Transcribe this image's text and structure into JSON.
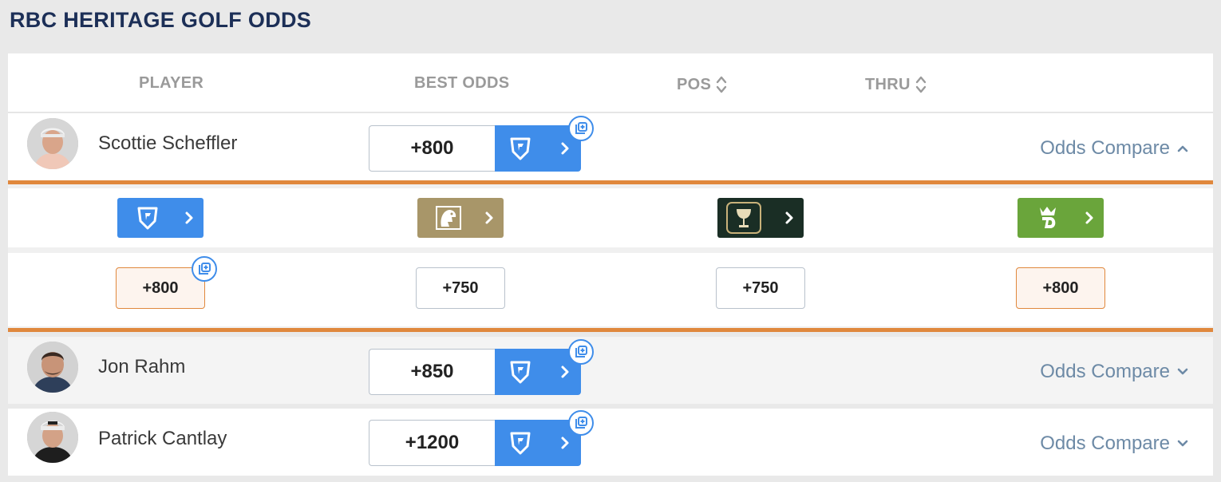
{
  "page": {
    "title": "RBC HERITAGE GOLF ODDS"
  },
  "columns": {
    "player": "PLAYER",
    "best_odds": "BEST ODDS",
    "pos": "POS",
    "thru": "THRU"
  },
  "icons": {
    "sort": "sort-updown-icon",
    "add": "add-bet-icon",
    "chevron_right": "chevron-right-icon",
    "chevron_up": "chevron-up-icon",
    "chevron_down": "chevron-down-icon",
    "fanduel": "fanduel-shield-icon",
    "betmgm": "betmgm-lion-icon",
    "caesars": "caesars-chalice-icon",
    "draftkings": "draftkings-crown-icon"
  },
  "colors": {
    "title": "#1c2f57",
    "accent_blue": "#3f8dea",
    "accent_orange": "#e0883d",
    "link": "#6d8aa6",
    "fanduel": "#3f8dea",
    "betmgm": "#a89669",
    "caesars": "#1a2e25",
    "draftkings": "#6aa53b"
  },
  "players": [
    {
      "name": "Scottie Scheffler",
      "best_odds": "+800",
      "compare_label": "Odds Compare",
      "expanded": true
    },
    {
      "name": "Jon Rahm",
      "best_odds": "+850",
      "compare_label": "Odds Compare",
      "expanded": false
    },
    {
      "name": "Patrick Cantlay",
      "best_odds": "+1200",
      "compare_label": "Odds Compare",
      "expanded": false
    }
  ],
  "compare": {
    "books": [
      "FanDuel",
      "BetMGM",
      "Caesars",
      "DraftKings"
    ],
    "odds": [
      {
        "value": "+800",
        "best": true
      },
      {
        "value": "+750",
        "best": false
      },
      {
        "value": "+750",
        "best": false
      },
      {
        "value": "+800",
        "best": true
      }
    ]
  }
}
